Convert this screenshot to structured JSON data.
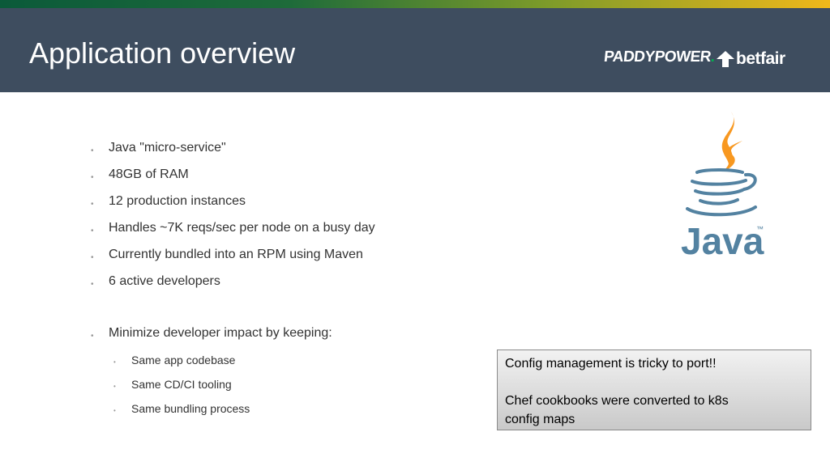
{
  "slide": {
    "title": "Application overview"
  },
  "logos": {
    "paddypower": "PADDYPOWER",
    "paddypower_dot": ".",
    "betfair": "betfair"
  },
  "bullets": [
    "Java \"micro-service\"",
    "48GB of RAM",
    "12 production instances",
    "Handles ~7K reqs/sec per node on a busy day",
    "Currently bundled into an RPM using Maven",
    "6 active developers",
    "Minimize developer impact by keeping:"
  ],
  "sub_bullets": [
    "Same app codebase",
    "Same CD/CI tooling",
    "Same bundling process"
  ],
  "bullet_glyph": "•",
  "java_logo": {
    "text": "Java",
    "tm": "™"
  },
  "note": {
    "line1": "Config management is tricky to port!!",
    "line2": "Chef cookbooks were converted to k8s",
    "line3": "config maps"
  },
  "colors": {
    "header_bg": "#3e4d5f",
    "java_blue": "#5382a1",
    "java_orange": "#f89820"
  }
}
